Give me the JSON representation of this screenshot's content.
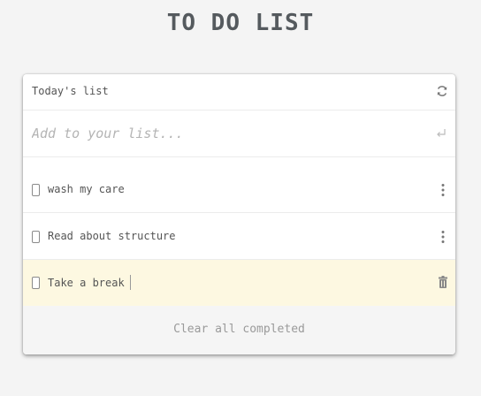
{
  "page": {
    "title": "TO DO LIST"
  },
  "list": {
    "header_label": "Today's list",
    "refresh_icon": "refresh-icon",
    "add_placeholder": "Add to your list...",
    "add_value": "",
    "enter_icon": "enter-icon",
    "items": [
      {
        "text": "wash my care",
        "completed": false,
        "action_icon": "more-icon"
      },
      {
        "text": "Read about structure",
        "completed": false,
        "action_icon": "more-icon"
      },
      {
        "text": "Take a break",
        "completed": false,
        "editing": true,
        "action_icon": "trash-icon"
      }
    ],
    "clear_label": "Clear all completed"
  },
  "colors": {
    "background": "#f4f4f4",
    "card": "#ffffff",
    "highlight_row": "#fdf8e1",
    "footer": "#f5f5f5",
    "title": "#555a5e",
    "text": "#555555",
    "muted": "#9a9a9a"
  }
}
